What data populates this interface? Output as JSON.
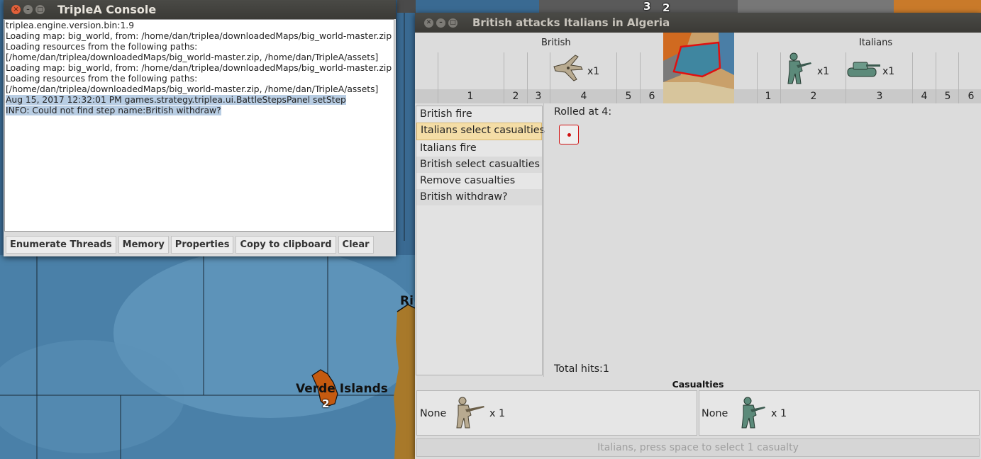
{
  "map": {
    "island_label": "Verde Islands",
    "island_units": "2",
    "coast_label": "Ri",
    "top_numbers": [
      "3",
      "2"
    ]
  },
  "console": {
    "title": "TripleA Console",
    "lines": [
      "triplea.engine.version.bin:1.9",
      "Loading map: big_world, from: /home/dan/triplea/downloadedMaps/big_world-master.zip",
      "Loading resources from the following paths:",
      "[/home/dan/triplea/downloadedMaps/big_world-master.zip, /home/dan/TripleA/assets]",
      "Loading map: big_world, from: /home/dan/triplea/downloadedMaps/big_world-master.zip",
      "Loading resources from the following paths:",
      "[/home/dan/triplea/downloadedMaps/big_world-master.zip, /home/dan/TripleA/assets]",
      "Aug 15, 2017 12:32:01 PM games.strategy.triplea.ui.BattleStepsPanel setStep",
      "INFO: Could not find step name:British withdraw?"
    ],
    "buttons": {
      "enumerate": "Enumerate Threads",
      "memory": "Memory",
      "properties": "Properties",
      "copy": "Copy to clipboard",
      "clear": "Clear"
    }
  },
  "battle": {
    "title": "British attacks Italians in Algeria",
    "attacker": {
      "name": "British",
      "columns": [
        "1",
        "2",
        "3",
        "4",
        "5",
        "6"
      ],
      "units": [
        {
          "icon": "bomber-icon",
          "count": "x1"
        }
      ]
    },
    "defender": {
      "name": "Italians",
      "columns": [
        "1",
        "2",
        "3",
        "4",
        "5",
        "6"
      ],
      "units": [
        {
          "icon": "infantry-icon",
          "count": "x1"
        },
        {
          "icon": "tank-icon",
          "count": "x1"
        }
      ]
    },
    "steps": [
      "British fire",
      "Italians select casualties",
      "Italians fire",
      "British select casualties",
      "Remove casualties",
      "British withdraw?"
    ],
    "active_step": "Italians select casualties",
    "rolled_at": "Rolled at 4:",
    "dice": [
      1
    ],
    "total_hits": "Total hits:1",
    "casualties": {
      "title": "Casualties",
      "attacker": {
        "label": "None",
        "count": "x 1"
      },
      "defender": {
        "label": "None",
        "count": "x 1"
      }
    },
    "status": "Italians, press space to select 1 casualty"
  },
  "colors": {
    "attacker_unit": "#b8aa90",
    "defender_unit": "#5c8a7a",
    "active_step": "#f4dda6",
    "die": "#d01010"
  }
}
